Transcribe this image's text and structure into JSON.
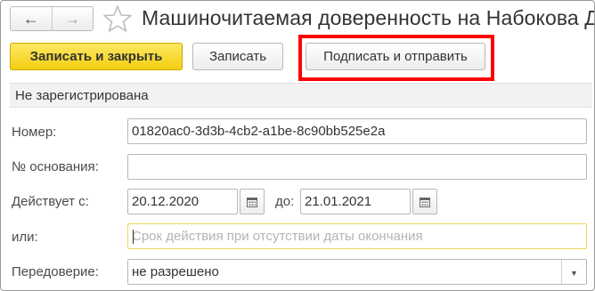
{
  "window": {
    "title": "Машиночитаемая доверенность на Набокова Д",
    "back_icon": "←",
    "forward_icon": "→"
  },
  "toolbar": {
    "save_close_label": "Записать и закрыть",
    "save_label": "Записать",
    "sign_send_label": "Подписать и отправить"
  },
  "status": {
    "text": "Не зарегистрирована"
  },
  "form": {
    "number": {
      "label": "Номер:",
      "value": "01820ac0-3d3b-4cb2-a1be-8c90bb525e2a"
    },
    "basis": {
      "label": "№ основания:",
      "value": ""
    },
    "valid_from": {
      "label": "Действует с:",
      "value": "20.12.2020"
    },
    "valid_to": {
      "label": "до:",
      "value": "21.01.2021"
    },
    "or_period": {
      "label": "или:",
      "value": "",
      "placeholder": "Срок действия при отсутствии даты окончания"
    },
    "redelegation": {
      "label": "Передоверие:",
      "value": "не разрешено"
    }
  },
  "colors": {
    "primary_button": "#f4cf10",
    "highlight": "#ff0000",
    "focus_border": "#f1d558"
  }
}
